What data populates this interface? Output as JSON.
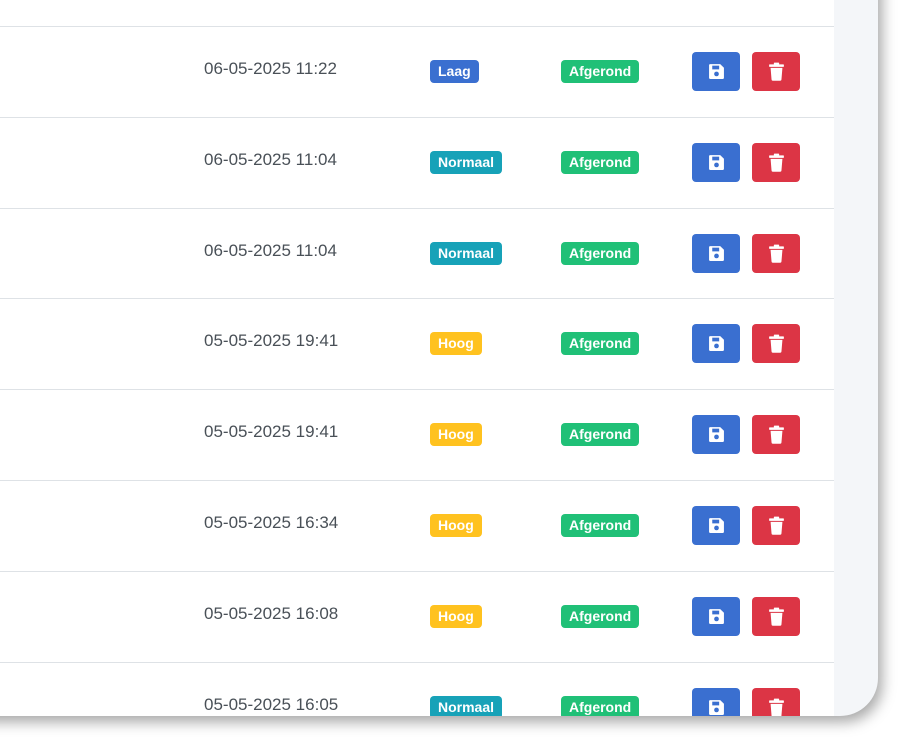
{
  "table": {
    "rows": [
      {
        "date": "06-05-2025 11:22",
        "priority": "Laag",
        "status": "Afgerond"
      },
      {
        "date": "06-05-2025 11:04",
        "priority": "Normaal",
        "status": "Afgerond"
      },
      {
        "date": "06-05-2025 11:04",
        "priority": "Normaal",
        "status": "Afgerond"
      },
      {
        "date": "05-05-2025 19:41",
        "priority": "Hoog",
        "status": "Afgerond"
      },
      {
        "date": "05-05-2025 19:41",
        "priority": "Hoog",
        "status": "Afgerond"
      },
      {
        "date": "05-05-2025 16:34",
        "priority": "Hoog",
        "status": "Afgerond"
      },
      {
        "date": "05-05-2025 16:08",
        "priority": "Hoog",
        "status": "Afgerond"
      },
      {
        "date": "05-05-2025 16:05",
        "priority": "Normaal",
        "status": "Afgerond"
      }
    ]
  },
  "colors": {
    "priority_laag": "#3a6fd0",
    "priority_normaal": "#17a2b8",
    "priority_hoog": "#ffc21f",
    "status_afgerond": "#20c077",
    "save_button": "#3a6fd0",
    "delete_button": "#dc3545"
  },
  "icons": {
    "save": "floppy-disk-icon",
    "delete": "trash-icon"
  }
}
